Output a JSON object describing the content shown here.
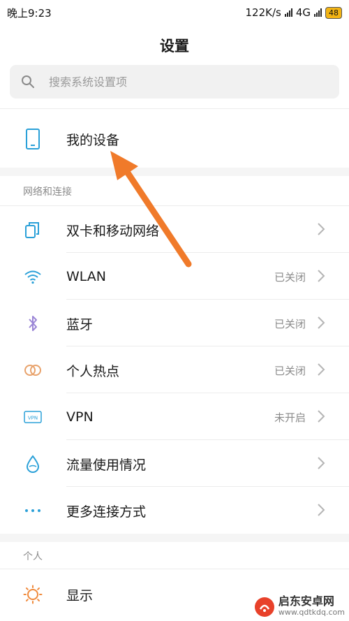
{
  "status_bar": {
    "time": "晚上9:23",
    "net_speed": "122K/s",
    "network": "4G",
    "battery": "48"
  },
  "header": {
    "title": "设置"
  },
  "search": {
    "placeholder": "搜索系统设置项"
  },
  "device": {
    "label": "我的设备"
  },
  "sections": {
    "network": "网络和连接",
    "personal": "个人"
  },
  "network_items": [
    {
      "label": "双卡和移动网络",
      "value": ""
    },
    {
      "label": "WLAN",
      "value": "已关闭"
    },
    {
      "label": "蓝牙",
      "value": "已关闭"
    },
    {
      "label": "个人热点",
      "value": "已关闭"
    },
    {
      "label": "VPN",
      "value": "未开启"
    },
    {
      "label": "流量使用情况",
      "value": ""
    },
    {
      "label": "更多连接方式",
      "value": ""
    }
  ],
  "personal_items": [
    {
      "label": "显示"
    }
  ],
  "icons": {
    "device": "phone-icon",
    "sim": "sim-card-icon",
    "wlan": "wifi-icon",
    "bluetooth": "bluetooth-icon",
    "hotspot": "hotspot-icon",
    "vpn": "vpn-icon",
    "data_usage": "droplet-icon",
    "more": "more-dots-icon",
    "display": "sun-icon",
    "chevron": "chevron-right-icon"
  },
  "colors": {
    "accent_blue": "#2aa0d8",
    "bluetooth_purple": "#9b86d6",
    "hotspot_orange": "#e8a26b",
    "display_orange": "#f08a3c",
    "annotation_arrow": "#f07a2a"
  },
  "watermark": {
    "title": "启东安卓网",
    "url": "www.qdtkdq.com"
  }
}
